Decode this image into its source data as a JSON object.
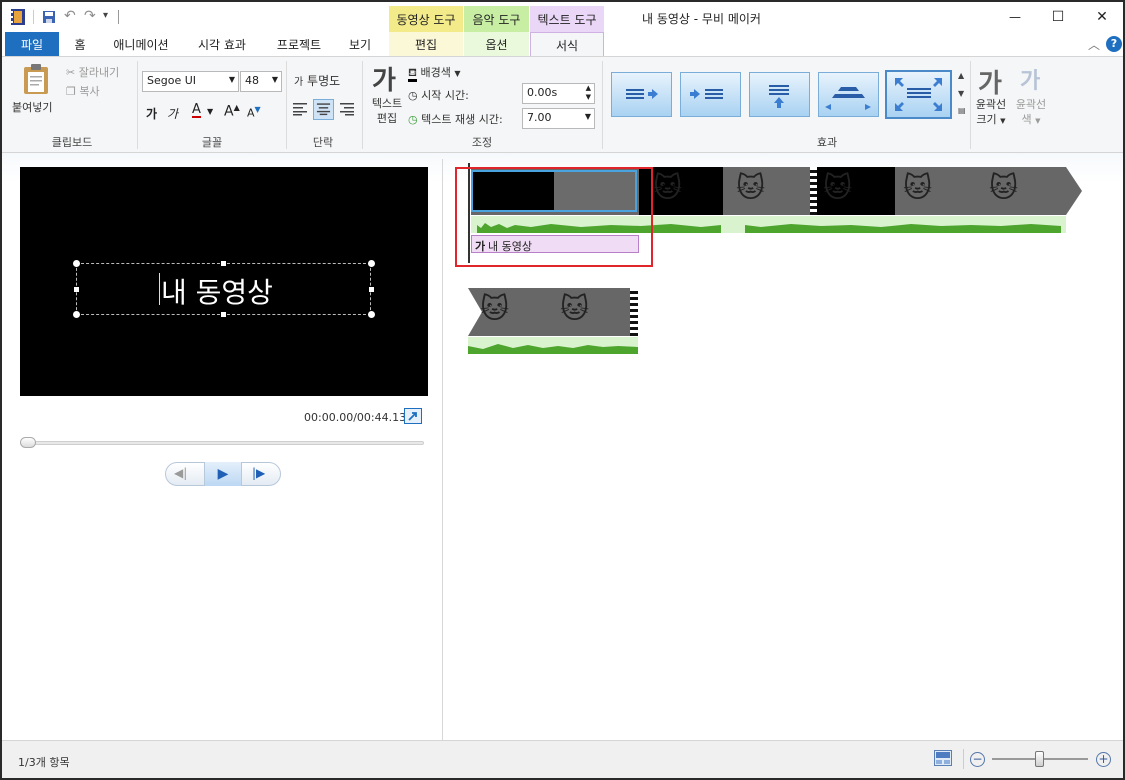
{
  "window": {
    "title": "내 동영상 - 무비 메이커",
    "minimize": "—",
    "maximize": "☐",
    "close": "✕"
  },
  "context_tabs": {
    "video_tools": "동영상 도구",
    "music_tools": "음악 도구",
    "text_tools": "텍스트 도구"
  },
  "tabs": {
    "file": "파일",
    "home": "홈",
    "animation": "애니메이션",
    "visual_effects": "시각 효과",
    "project": "프로젝트",
    "view": "보기",
    "edit": "편집",
    "options": "옵션",
    "format": "서식"
  },
  "ribbon": {
    "clipboard": {
      "paste": "붙여넣기",
      "cut": "잘라내기",
      "copy": "복사",
      "label": "클립보드"
    },
    "font": {
      "family": "Segoe UI",
      "size": "48",
      "bold_glyph": "가",
      "italic_glyph": "가",
      "color_glyph": "A",
      "grow_glyph": "A",
      "shrink_glyph": "A",
      "label": "글꼴"
    },
    "paragraph": {
      "transparency": "투명도",
      "label": "단락"
    },
    "adjust": {
      "edit_text": "텍스트 편집",
      "background_color": "배경색",
      "start_time_label": "시작 시간:",
      "start_time_value": "0.00s",
      "duration_label": "텍스트 재생 시간:",
      "duration_value": "7.00",
      "label": "조정"
    },
    "effects": {
      "label": "효과",
      "outline_size": "윤곽선 크기",
      "outline_color": "윤곽선 색"
    }
  },
  "preview": {
    "caption": "내 동영상",
    "time": "00:00.00/00:44.13"
  },
  "timeline": {
    "title_clip_label": "내 동영상"
  },
  "status": {
    "items": "1/3개 항목"
  },
  "colors": {
    "file_tab": "#1f6fc1",
    "video_tools": "#f3ea8a",
    "music_tools": "#c8eea4",
    "text_tools": "#ead7f7",
    "selection_box": "#e0262a"
  }
}
